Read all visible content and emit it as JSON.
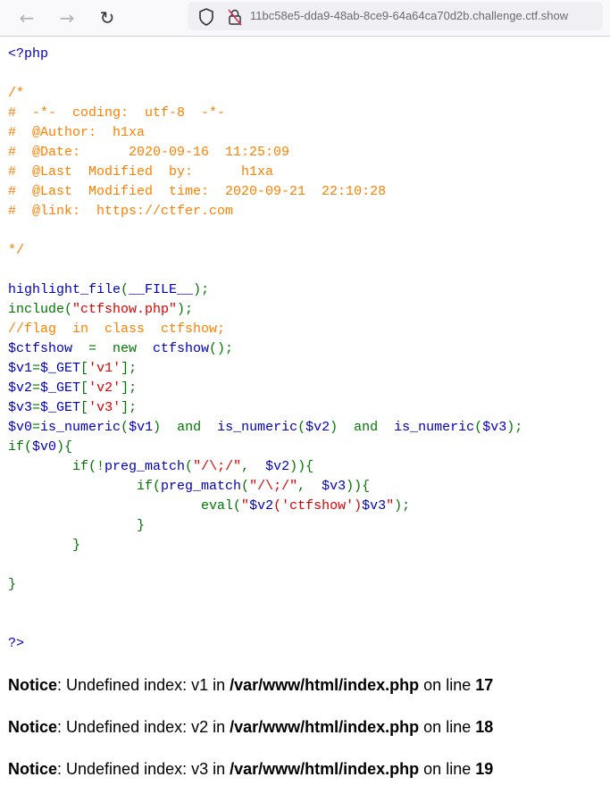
{
  "browser": {
    "url": "11bc58e5-dda9-48ab-8ce9-64a64ca70d2b.challenge.ctf.show"
  },
  "colors": {
    "default": "#0000BB",
    "keyword": "#007700",
    "string": "#DD0000",
    "comment": "#FF8000"
  },
  "code_lines": [
    [
      [
        "d",
        "<?php"
      ]
    ],
    [],
    [
      [
        "c",
        "/*"
      ]
    ],
    [
      [
        "c",
        "#  -*-  coding:  utf-8  -*-"
      ]
    ],
    [
      [
        "c",
        "#  @Author:  h1xa"
      ]
    ],
    [
      [
        "c",
        "#  @Date:      2020-09-16  11:25:09"
      ]
    ],
    [
      [
        "c",
        "#  @Last  Modified  by:      h1xa"
      ]
    ],
    [
      [
        "c",
        "#  @Last  Modified  time:  2020-09-21  22:10:28"
      ]
    ],
    [
      [
        "c",
        "#  @link:  https://ctfer.com"
      ]
    ],
    [],
    [
      [
        "c",
        "*/"
      ]
    ],
    [],
    [
      [
        "d",
        "highlight_file"
      ],
      [
        "k",
        "("
      ],
      [
        "d",
        "__FILE__"
      ],
      [
        "k",
        ");"
      ]
    ],
    [
      [
        "k",
        "include("
      ],
      [
        "s",
        "\"ctfshow.php\""
      ],
      [
        "k",
        ");"
      ]
    ],
    [
      [
        "c",
        "//flag  in  class  ctfshow;"
      ]
    ],
    [
      [
        "d",
        "$ctfshow "
      ],
      [
        "k",
        " =  new  "
      ],
      [
        "d",
        "ctfshow"
      ],
      [
        "k",
        "();"
      ]
    ],
    [
      [
        "d",
        "$v1"
      ],
      [
        "k",
        "="
      ],
      [
        "d",
        "$_GET"
      ],
      [
        "k",
        "["
      ],
      [
        "s",
        "'v1'"
      ],
      [
        "k",
        "];"
      ]
    ],
    [
      [
        "d",
        "$v2"
      ],
      [
        "k",
        "="
      ],
      [
        "d",
        "$_GET"
      ],
      [
        "k",
        "["
      ],
      [
        "s",
        "'v2'"
      ],
      [
        "k",
        "];"
      ]
    ],
    [
      [
        "d",
        "$v3"
      ],
      [
        "k",
        "="
      ],
      [
        "d",
        "$_GET"
      ],
      [
        "k",
        "["
      ],
      [
        "s",
        "'v3'"
      ],
      [
        "k",
        "];"
      ]
    ],
    [
      [
        "d",
        "$v0"
      ],
      [
        "k",
        "="
      ],
      [
        "d",
        "is_numeric"
      ],
      [
        "k",
        "("
      ],
      [
        "d",
        "$v1"
      ],
      [
        "k",
        ")  and  "
      ],
      [
        "d",
        "is_numeric"
      ],
      [
        "k",
        "("
      ],
      [
        "d",
        "$v2"
      ],
      [
        "k",
        ")  and  "
      ],
      [
        "d",
        "is_numeric"
      ],
      [
        "k",
        "("
      ],
      [
        "d",
        "$v3"
      ],
      [
        "k",
        ");"
      ]
    ],
    [
      [
        "k",
        "if("
      ],
      [
        "d",
        "$v0"
      ],
      [
        "k",
        "){"
      ]
    ],
    [
      [
        "k",
        "        if(!"
      ],
      [
        "d",
        "preg_match"
      ],
      [
        "k",
        "("
      ],
      [
        "s",
        "\"/\\;/\""
      ],
      [
        "k",
        ",  "
      ],
      [
        "d",
        "$v2"
      ],
      [
        "k",
        ")){"
      ]
    ],
    [
      [
        "k",
        "                if("
      ],
      [
        "d",
        "preg_match"
      ],
      [
        "k",
        "("
      ],
      [
        "s",
        "\"/\\;/\""
      ],
      [
        "k",
        ",  "
      ],
      [
        "d",
        "$v3"
      ],
      [
        "k",
        ")){"
      ]
    ],
    [
      [
        "k",
        "                        eval("
      ],
      [
        "s",
        "\""
      ],
      [
        "d",
        "$v2"
      ],
      [
        "s",
        "('ctfshow')"
      ],
      [
        "d",
        "$v3"
      ],
      [
        "s",
        "\""
      ],
      [
        "k",
        ");"
      ]
    ],
    [
      [
        "k",
        "                }"
      ]
    ],
    [
      [
        "k",
        "        }"
      ]
    ],
    [],
    [
      [
        "k",
        "}"
      ]
    ],
    [],
    [],
    [
      [
        "d",
        "?>"
      ]
    ]
  ],
  "notices": [
    {
      "label": "Notice",
      "message": ": Undefined index: v1 in ",
      "file": "/var/www/html/index.php",
      "on_line": " on line ",
      "line": "17"
    },
    {
      "label": "Notice",
      "message": ": Undefined index: v2 in ",
      "file": "/var/www/html/index.php",
      "on_line": " on line ",
      "line": "18"
    },
    {
      "label": "Notice",
      "message": ": Undefined index: v3 in ",
      "file": "/var/www/html/index.php",
      "on_line": " on line ",
      "line": "19"
    }
  ]
}
